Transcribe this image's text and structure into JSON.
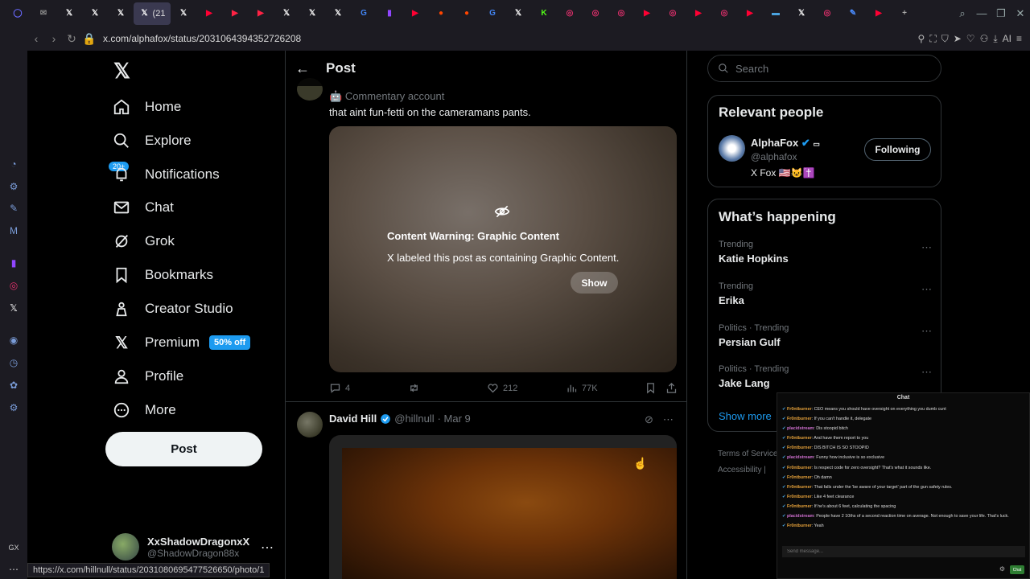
{
  "browser": {
    "tabs": [
      {
        "icon": "browser-menu-icon",
        "color": "#6a6aff",
        "glyph": "◯"
      },
      {
        "icon": "mail-icon",
        "color": "#888888",
        "glyph": "✉"
      },
      {
        "icon": "x-icon",
        "color": "#ffffff",
        "glyph": "𝕏"
      },
      {
        "icon": "x-icon",
        "color": "#ffffff",
        "glyph": "𝕏"
      },
      {
        "icon": "x-icon",
        "color": "#ffffff",
        "glyph": "𝕏"
      },
      {
        "icon": "x-icon",
        "color": "#ffffff",
        "glyph": "𝕏",
        "active": true,
        "text": "(21"
      },
      {
        "icon": "x-icon",
        "color": "#ffffff",
        "glyph": "𝕏"
      },
      {
        "icon": "youtube-icon",
        "color": "#ff0033",
        "glyph": "▶"
      },
      {
        "icon": "red-app-icon",
        "color": "#ff2244",
        "glyph": "▶"
      },
      {
        "icon": "red-app-icon",
        "color": "#ff2244",
        "glyph": "▶"
      },
      {
        "icon": "x-icon",
        "color": "#ffffff",
        "glyph": "𝕏"
      },
      {
        "icon": "x-icon",
        "color": "#ffffff",
        "glyph": "𝕏"
      },
      {
        "icon": "x-icon",
        "color": "#ffffff",
        "glyph": "𝕏"
      },
      {
        "icon": "google-icon",
        "color": "#4285f4",
        "glyph": "G"
      },
      {
        "icon": "twitch-icon",
        "color": "#9146ff",
        "glyph": "▮"
      },
      {
        "icon": "youtube-icon",
        "color": "#ff0033",
        "glyph": "▶"
      },
      {
        "icon": "reddit-icon",
        "color": "#ff4500",
        "glyph": "●"
      },
      {
        "icon": "reddit-icon",
        "color": "#ff4500",
        "glyph": "●"
      },
      {
        "icon": "google-icon",
        "color": "#4285f4",
        "glyph": "G"
      },
      {
        "icon": "x-icon",
        "color": "#ffffff",
        "glyph": "𝕏"
      },
      {
        "icon": "kick-icon",
        "color": "#53fc18",
        "glyph": "K"
      },
      {
        "icon": "instagram-icon",
        "color": "#e1306c",
        "glyph": "◎"
      },
      {
        "icon": "instagram-icon",
        "color": "#e1306c",
        "glyph": "◎"
      },
      {
        "icon": "instagram-icon",
        "color": "#e1306c",
        "glyph": "◎"
      },
      {
        "icon": "youtube-icon",
        "color": "#ff0033",
        "glyph": "▶"
      },
      {
        "icon": "instagram-icon",
        "color": "#e1306c",
        "glyph": "◎"
      },
      {
        "icon": "youtube-icon",
        "color": "#ff0033",
        "glyph": "▶"
      },
      {
        "icon": "instagram-icon",
        "color": "#e1306c",
        "glyph": "◎"
      },
      {
        "icon": "youtube-icon",
        "color": "#ff0033",
        "glyph": "▶"
      },
      {
        "icon": "app-icon",
        "color": "#4aa3df",
        "glyph": "▬"
      },
      {
        "icon": "x-icon",
        "color": "#ffffff",
        "glyph": "𝕏"
      },
      {
        "icon": "instagram-icon",
        "color": "#e1306c",
        "glyph": "◎"
      },
      {
        "icon": "pen-icon",
        "color": "#4a8cff",
        "glyph": "✎"
      },
      {
        "icon": "youtube-icon",
        "color": "#ff0033",
        "glyph": "▶"
      },
      {
        "icon": "new-tab-icon",
        "color": "#aaaaaa",
        "glyph": "+"
      }
    ],
    "url": "x.com/alphafox/status/2031064394352726208",
    "ai_label": "AI",
    "status_url": "https://x.com/hillnull/status/2031080695477526650/photo/1"
  },
  "nav": {
    "items": [
      {
        "label": "Home",
        "icon": "home-icon"
      },
      {
        "label": "Explore",
        "icon": "search-icon"
      },
      {
        "label": "Notifications",
        "icon": "bell-icon"
      },
      {
        "label": "Chat",
        "icon": "mail-icon"
      },
      {
        "label": "Grok",
        "icon": "grok-icon"
      },
      {
        "label": "Bookmarks",
        "icon": "bookmark-icon"
      },
      {
        "label": "Creator Studio",
        "icon": "creator-studio-icon"
      },
      {
        "label": "Premium",
        "icon": "x-icon"
      },
      {
        "label": "Profile",
        "icon": "person-icon"
      },
      {
        "label": "More",
        "icon": "more-icon"
      }
    ],
    "notifications_badge": "20+",
    "premium_badge": "50% off",
    "post_button": "Post"
  },
  "account": {
    "name": "XxShadowDragonxX",
    "handle": "@ShadowDragon88x"
  },
  "main": {
    "title": "Post",
    "tweet1": {
      "label": "Commentary account",
      "text": "that aint fun-fetti on the cameramans pants.",
      "warning_title": "Content Warning: Graphic Content",
      "warning_desc": "X labeled this post as containing Graphic Content.",
      "show_button": "Show",
      "replies": "4",
      "likes": "212",
      "views": "77K"
    },
    "tweet2": {
      "name": "David Hill",
      "handle": "@hillnull",
      "date": "· Mar 9"
    }
  },
  "sidebar": {
    "search_placeholder": "Search",
    "relevant_title": "Relevant people",
    "relevant_person": {
      "name": "AlphaFox",
      "handle": "@alphafox",
      "bio": "X Fox 🇺🇸😺✝️",
      "follow_button": "Following"
    },
    "happening_title": "What’s happening",
    "trends": [
      {
        "category": "Trending",
        "name": "Katie Hopkins"
      },
      {
        "category": "Trending",
        "name": "Erika"
      },
      {
        "category": "Politics · Trending",
        "name": "Persian Gulf"
      },
      {
        "category": "Politics · Trending",
        "name": "Jake Lang"
      }
    ],
    "show_more": "Show more",
    "footer": [
      "Terms of Service",
      "Accessibility |"
    ]
  },
  "chat": {
    "title": "Chat",
    "lines": [
      {
        "user": "Fr0ntburner",
        "text": ": CEO means you should have oversight on everything you dumb cunt",
        "color": "#e8a33a"
      },
      {
        "user": "Fr0ntburner",
        "text": ": If you can't handle it, delegate",
        "color": "#e8a33a"
      },
      {
        "user": "placidstream",
        "text": ": Dis stoopid bitch",
        "color": "#d070d0"
      },
      {
        "user": "Fr0ntburner",
        "text": ": And have them report to you",
        "color": "#e8a33a"
      },
      {
        "user": "Fr0ntburner",
        "text": ": DIS BITCH IS SO STOOPID",
        "color": "#e8a33a"
      },
      {
        "user": "placidstream",
        "text": ": Funny how inclusive is so exclusive",
        "color": "#d070d0"
      },
      {
        "user": "Fr0ntburner",
        "text": ": Is respect code for zero oversight? That's what it sounds like.",
        "color": "#e8a33a"
      },
      {
        "user": "Fr0ntburner",
        "text": ": Oh damn",
        "color": "#e8a33a"
      },
      {
        "user": "Fr0ntburner",
        "text": ": That falls under the 'be aware of your target' part of the gun safety rules.",
        "color": "#e8a33a"
      },
      {
        "user": "Fr0ntburner",
        "text": ": Like 4 feet clearance",
        "color": "#e8a33a"
      },
      {
        "user": "Fr0ntburner",
        "text": ": If he's about 6 feet, calculating the spacing",
        "color": "#e8a33a"
      },
      {
        "user": "placidstream",
        "text": ": People have 2 10ths of a second reaction time on average. Not enough to save your life. That's luck.",
        "color": "#d070d0"
      },
      {
        "user": "Fr0ntburner",
        "text": ": Yeah",
        "color": "#e8a33a"
      }
    ],
    "input_placeholder": "Send message...",
    "send_button": "Chat"
  }
}
